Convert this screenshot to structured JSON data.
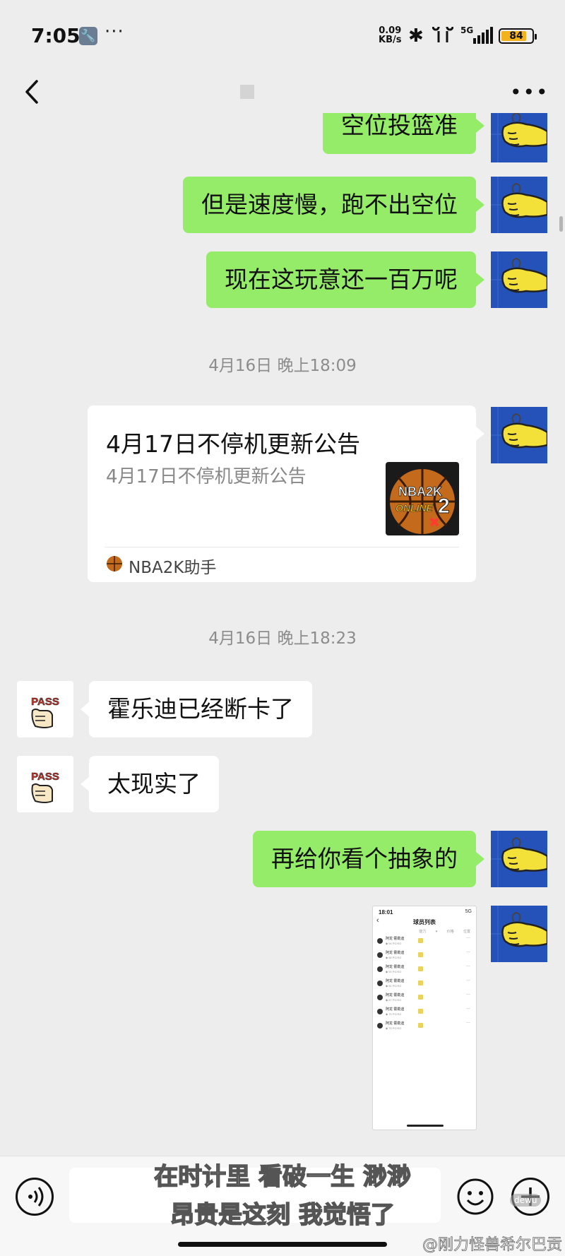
{
  "status_bar": {
    "time": "7:05",
    "dots": "···",
    "net_speed_value": "0.09",
    "net_speed_unit": "KB/s",
    "network": "5G",
    "battery": "84",
    "battery_level": 0.84
  },
  "nav": {
    "back_icon": "chevron-left-icon",
    "title": "",
    "more_icon": "more-dots-icon"
  },
  "messages": [
    {
      "from": "me",
      "type": "text",
      "text": "空位投篮准"
    },
    {
      "from": "me",
      "type": "text",
      "text": "但是速度慢，跑不出空位"
    },
    {
      "from": "me",
      "type": "text",
      "text": "现在这玩意还一百万呢"
    },
    {
      "type": "timestamp",
      "text": "4月16日 晚上18:09"
    },
    {
      "from": "me",
      "type": "card",
      "title": "4月17日不停机更新公告",
      "description": "4月17日不停机更新公告",
      "thumbnail_text_1": "NBA2K",
      "thumbnail_text_2": "ONLINE",
      "thumbnail_text_3": "2",
      "source": "NBA2K助手"
    },
    {
      "type": "timestamp",
      "text": "4月16日 晚上18:23"
    },
    {
      "from": "them",
      "type": "text",
      "text": "霍乐迪已经断卡了"
    },
    {
      "from": "them",
      "type": "text",
      "text": "太现实了"
    },
    {
      "from": "me",
      "type": "text",
      "text": "再给你看个抽象的"
    },
    {
      "from": "me",
      "type": "image",
      "screenshot": {
        "time": "18:01",
        "status": "5G",
        "title": "球员列表",
        "tabs": "能力 ▾ 价格 位置",
        "rows": [
          {
            "name": "阿龙 霍勒迪",
            "sub": "◆ 94 PG/SG"
          },
          {
            "name": "阿龙 霍勒迪",
            "sub": "◆ 88 PG/SG"
          },
          {
            "name": "阿龙 霍勒迪",
            "sub": "◆ 90 PG/SG"
          },
          {
            "name": "阿龙 霍勒迪",
            "sub": "◆ 84 PG/SG"
          },
          {
            "name": "阿龙 霍勒迪",
            "sub": "◆ 87 PG/SG"
          },
          {
            "name": "阿龙 霍勒迪",
            "sub": "◆ 75 PG/SG"
          },
          {
            "name": "阿龙 霍勒迪",
            "sub": "◆ 78 PG/SG"
          }
        ]
      }
    }
  ],
  "avatars": {
    "me": "yellow-fist-icon",
    "them": "pass-sticker-icon",
    "them_text": "PASS"
  },
  "input_bar": {
    "voice_icon": "voice-icon",
    "emoji_icon": "emoji-icon",
    "plus_icon": "plus-icon",
    "value": ""
  },
  "overlay": {
    "subtitle_line_1": "在时计里 看破一生 渺渺",
    "subtitle_line_2_highlight": "昂贵是这",
    "subtitle_line_2_rest": "刻 我觉悟了",
    "watermark": "@刚力怪兽希尔巴贡",
    "badge": "dewu"
  }
}
